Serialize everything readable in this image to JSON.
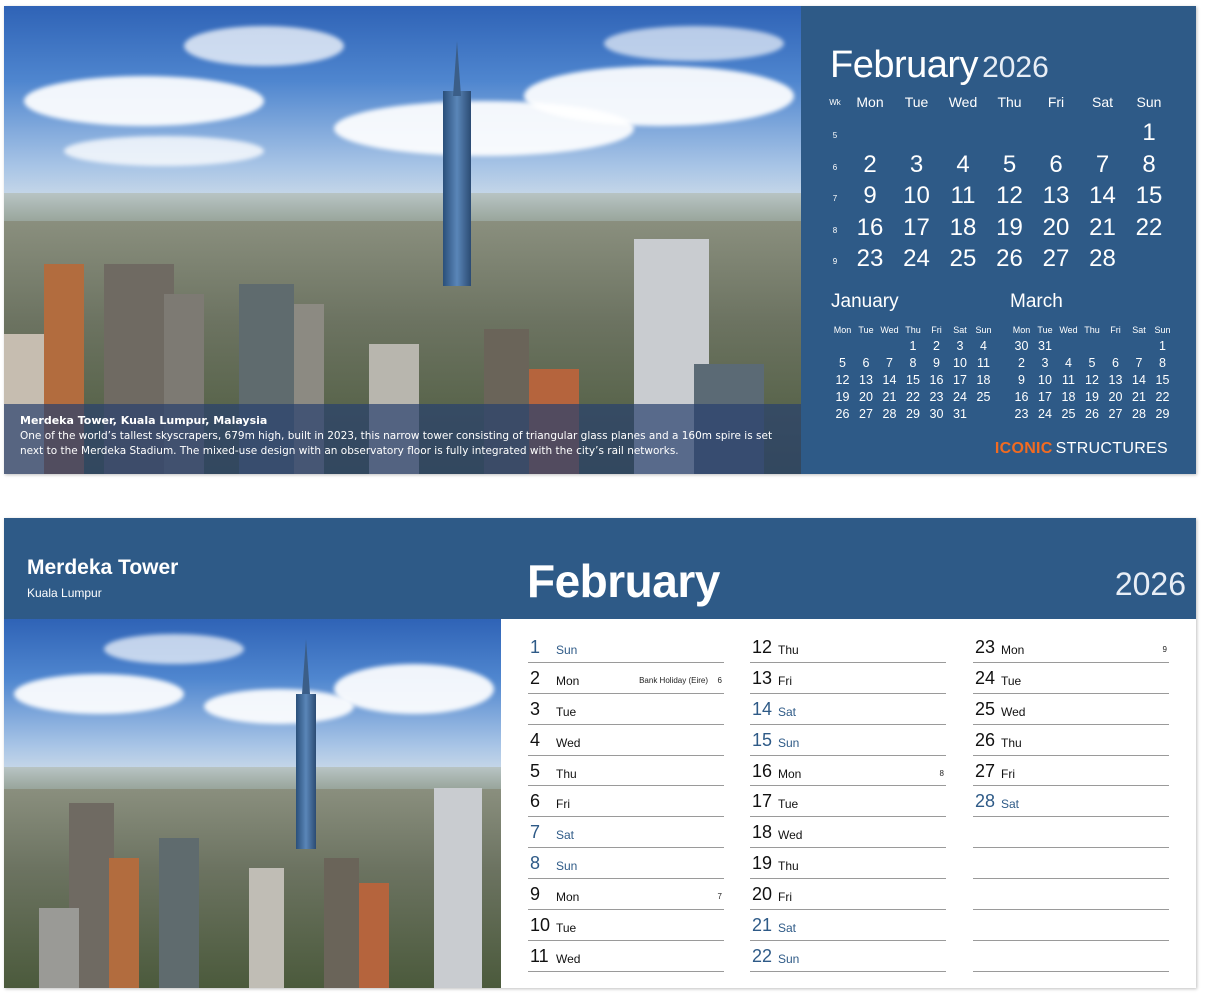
{
  "top": {
    "caption": {
      "title": "Merdeka Tower, Kuala Lumpur, Malaysia",
      "text": "One of the world’s tallest skyscrapers, 679m high, built in 2023, this narrow tower consisting of triangular glass planes and a 160m spire is set next to the Merdeka Stadium. The mixed-use design with an observatory floor is fully integrated with the city’s rail networks."
    },
    "month_name": "February",
    "year": "2026",
    "wk_label": "Wk",
    "weekdays": [
      "Mon",
      "Tue",
      "Wed",
      "Thu",
      "Fri",
      "Sat",
      "Sun"
    ],
    "week_numbers": [
      "5",
      "6",
      "7",
      "8",
      "9"
    ],
    "weeks": [
      [
        "",
        "",
        "",
        "",
        "",
        "",
        "1"
      ],
      [
        "2",
        "3",
        "4",
        "5",
        "6",
        "7",
        "8"
      ],
      [
        "9",
        "10",
        "11",
        "12",
        "13",
        "14",
        "15"
      ],
      [
        "16",
        "17",
        "18",
        "19",
        "20",
        "21",
        "22"
      ],
      [
        "23",
        "24",
        "25",
        "26",
        "27",
        "28",
        ""
      ]
    ],
    "prev_month": {
      "name": "January",
      "weekdays": [
        "Mon",
        "Tue",
        "Wed",
        "Thu",
        "Fri",
        "Sat",
        "Sun"
      ],
      "weeks": [
        [
          "",
          "",
          "",
          "1",
          "2",
          "3",
          "4"
        ],
        [
          "5",
          "6",
          "7",
          "8",
          "9",
          "10",
          "11"
        ],
        [
          "12",
          "13",
          "14",
          "15",
          "16",
          "17",
          "18"
        ],
        [
          "19",
          "20",
          "21",
          "22",
          "23",
          "24",
          "25"
        ],
        [
          "26",
          "27",
          "28",
          "29",
          "30",
          "31",
          ""
        ]
      ]
    },
    "next_month": {
      "name": "March",
      "weekdays": [
        "Mon",
        "Tue",
        "Wed",
        "Thu",
        "Fri",
        "Sat",
        "Sun"
      ],
      "weeks": [
        [
          "30",
          "31",
          "",
          "",
          "",
          "",
          "1"
        ],
        [
          "2",
          "3",
          "4",
          "5",
          "6",
          "7",
          "8"
        ],
        [
          "9",
          "10",
          "11",
          "12",
          "13",
          "14",
          "15"
        ],
        [
          "16",
          "17",
          "18",
          "19",
          "20",
          "21",
          "22"
        ],
        [
          "23",
          "24",
          "25",
          "26",
          "27",
          "28",
          "29"
        ]
      ]
    },
    "brand": {
      "part1": "ICONIC",
      "part2": "STRUCTURES"
    }
  },
  "bottom": {
    "place_title": "Merdeka Tower",
    "place_sub": "Kuala Lumpur",
    "month_name": "February",
    "year": "2026",
    "columns": [
      [
        {
          "num": "1",
          "dow": "Sun",
          "weekend": true
        },
        {
          "num": "2",
          "dow": "Mon",
          "note": "Bank Holiday (Eire)",
          "week": "6"
        },
        {
          "num": "3",
          "dow": "Tue"
        },
        {
          "num": "4",
          "dow": "Wed"
        },
        {
          "num": "5",
          "dow": "Thu"
        },
        {
          "num": "6",
          "dow": "Fri"
        },
        {
          "num": "7",
          "dow": "Sat",
          "weekend": true
        },
        {
          "num": "8",
          "dow": "Sun",
          "weekend": true
        },
        {
          "num": "9",
          "dow": "Mon",
          "week": "7"
        },
        {
          "num": "10",
          "dow": "Tue"
        },
        {
          "num": "11",
          "dow": "Wed"
        }
      ],
      [
        {
          "num": "12",
          "dow": "Thu"
        },
        {
          "num": "13",
          "dow": "Fri"
        },
        {
          "num": "14",
          "dow": "Sat",
          "weekend": true
        },
        {
          "num": "15",
          "dow": "Sun",
          "weekend": true
        },
        {
          "num": "16",
          "dow": "Mon",
          "week": "8"
        },
        {
          "num": "17",
          "dow": "Tue"
        },
        {
          "num": "18",
          "dow": "Wed"
        },
        {
          "num": "19",
          "dow": "Thu"
        },
        {
          "num": "20",
          "dow": "Fri"
        },
        {
          "num": "21",
          "dow": "Sat",
          "weekend": true
        },
        {
          "num": "22",
          "dow": "Sun",
          "weekend": true
        }
      ],
      [
        {
          "num": "23",
          "dow": "Mon",
          "week": "9"
        },
        {
          "num": "24",
          "dow": "Tue"
        },
        {
          "num": "25",
          "dow": "Wed"
        },
        {
          "num": "26",
          "dow": "Thu"
        },
        {
          "num": "27",
          "dow": "Fri"
        },
        {
          "num": "28",
          "dow": "Sat",
          "weekend": true
        },
        {
          "num": "",
          "dow": ""
        },
        {
          "num": "",
          "dow": ""
        },
        {
          "num": "",
          "dow": ""
        },
        {
          "num": "",
          "dow": ""
        },
        {
          "num": "",
          "dow": ""
        }
      ]
    ]
  },
  "colors": {
    "panel": "#2e5a87",
    "accent": "#f26b21",
    "weekend": "#2e5a87"
  }
}
